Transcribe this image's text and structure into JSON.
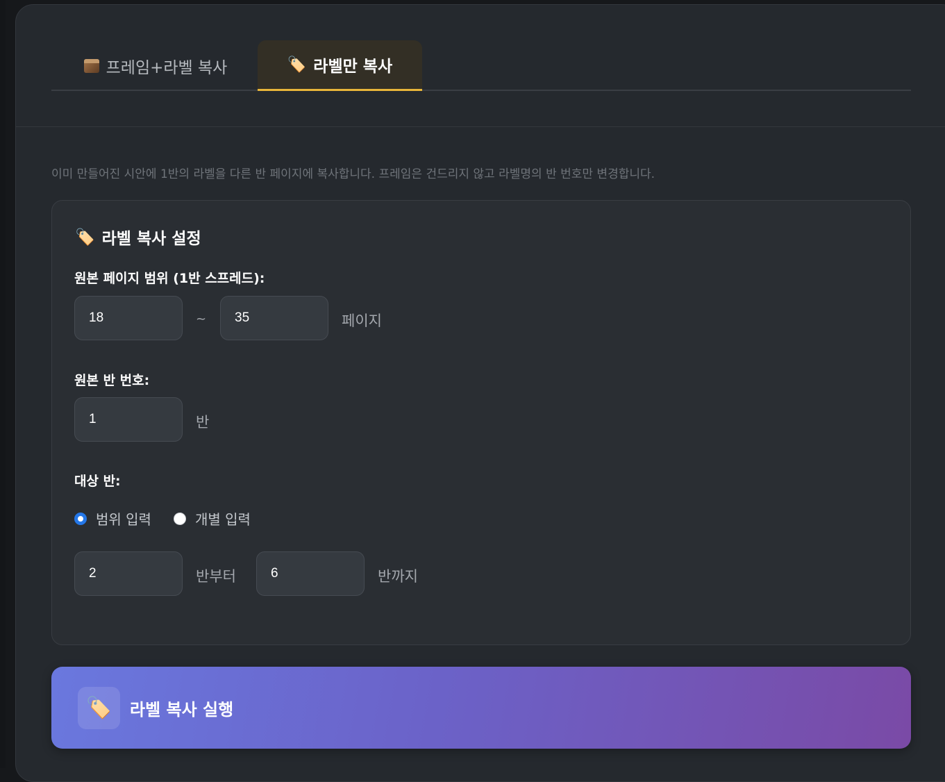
{
  "tabs": [
    {
      "label": "프레임+라벨 복사",
      "icon": "box-icon",
      "active": false
    },
    {
      "label": "라벨만 복사",
      "icon": "tag-icon",
      "active": true
    }
  ],
  "description": "이미 만들어진 시안에 1반의 라벨을 다른 반 페이지에 복사합니다. 프레임은 건드리지 않고 라벨명의 반 번호만 변경합니다.",
  "settings": {
    "title": "라벨 복사 설정",
    "title_icon": "tag-icon",
    "page_range": {
      "label": "원본 페이지 범위 (1반 스프레드):",
      "from": "18",
      "separator": "~",
      "to": "35",
      "unit": "페이지"
    },
    "source_class": {
      "label": "원본 반 번호:",
      "value": "1",
      "unit": "반"
    },
    "target_class": {
      "label": "대상 반:",
      "mode_options": [
        {
          "label": "범위 입력",
          "selected": true
        },
        {
          "label": "개별 입력",
          "selected": false
        }
      ],
      "from": "2",
      "from_unit": "반부터",
      "to": "6",
      "to_unit": "반까지"
    }
  },
  "run_button": {
    "label": "라벨 복사 실행",
    "icon": "tag-icon"
  },
  "colors": {
    "panel_bg": "#25292e",
    "active_tab_underline": "#e9b63a",
    "radio_selected": "#2477e8",
    "button_gradient_start": "#6a78de",
    "button_gradient_end": "#7a4aa6"
  }
}
